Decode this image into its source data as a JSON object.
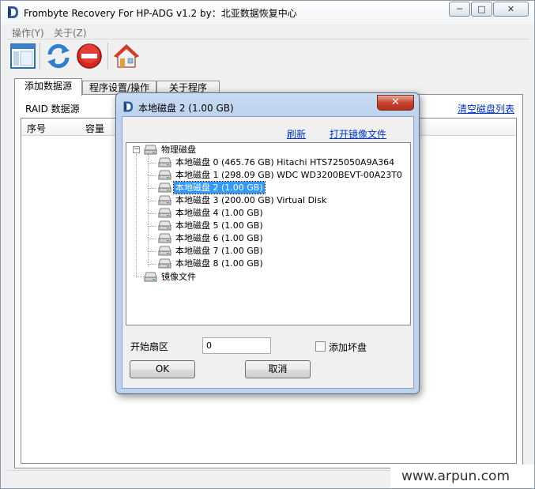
{
  "window": {
    "title": "Frombyte Recovery For HP-ADG v1.2 by：北亚数据恢复中心",
    "minimize": "─",
    "maximize": "□",
    "close": "✕"
  },
  "menu": [
    "操作(Y)",
    "关于(Z)"
  ],
  "toolbar": {
    "icons": [
      "layout-icon",
      "refresh-icon",
      "stop-icon",
      "home-icon"
    ]
  },
  "tabs": [
    {
      "label": "添加数据源",
      "active": true
    },
    {
      "label": "程序设置/操作",
      "active": false
    },
    {
      "label": "关于程序",
      "active": false
    }
  ],
  "panel": {
    "raid_label": "RAID 数据源",
    "clear_link": "清空磁盘列表",
    "columns": [
      "序号",
      "容量"
    ]
  },
  "dialog": {
    "title": "本地磁盘 2  (1.00 GB)",
    "refresh_link": "刷新",
    "open_image_link": "打开镜像文件",
    "tree": {
      "root_label": "物理磁盘",
      "disks": [
        "本地磁盘 0  (465.76 GB) Hitachi HTS725050A9A364",
        "本地磁盘 1  (298.09 GB) WDC WD3200BEVT-00A23T0",
        "本地磁盘 2  (1.00 GB)",
        "本地磁盘 3  (200.00 GB) Virtual Disk",
        "本地磁盘 4  (1.00 GB)",
        "本地磁盘 5  (1.00 GB)",
        "本地磁盘 6  (1.00 GB)",
        "本地磁盘 7  (1.00 GB)",
        "本地磁盘 8  (1.00 GB)"
      ],
      "selected_index": 2,
      "image_label": "镜像文件"
    },
    "start_sector_label": "开始扇区",
    "start_sector_value": "0",
    "add_bad_label": "添加坏盘",
    "ok_label": "OK",
    "cancel_label": "取消"
  },
  "watermark": "www.arpun.com",
  "colors": {
    "link": "#0033cc",
    "selection": "#3399ff",
    "dialog_frame": "#bcd2ee",
    "close_button": "#c7432d"
  }
}
